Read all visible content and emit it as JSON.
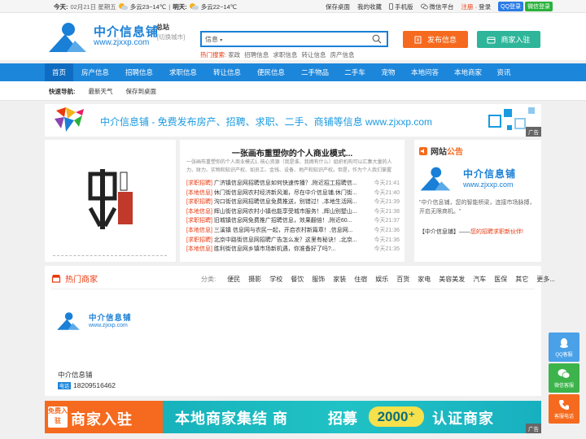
{
  "topbar": {
    "today_label": "今天:",
    "date": "02月21日 星期五",
    "today_weather": "多云23~14℃",
    "tomorrow_label": "明天:",
    "tomorrow_weather": "多云22~14℃",
    "links": [
      "保存桌面",
      "我的收藏",
      "手机版",
      "微信平台"
    ],
    "register": "注册",
    "login": "登录",
    "qq_login": "QQ登录",
    "wechat_login": "微信登录"
  },
  "header": {
    "logo_text": "中介信息铺",
    "logo_url": "www.zjxxp.com",
    "site_name": "总站",
    "switch_city": "[切换城市]",
    "search_type": "信息",
    "hot_label": "热门搜索:",
    "hot_keywords": [
      "家政",
      "招聘信息",
      "求职信息",
      "转让信息",
      "房产信息"
    ],
    "post_button": "发布信息",
    "join_button": "商家入驻"
  },
  "nav": {
    "items": [
      "首页",
      "房产信息",
      "招聘信息",
      "求职信息",
      "转让信息",
      "便民信息",
      "二手物品",
      "二手车",
      "宠物",
      "本地问答",
      "本地商家",
      "资讯"
    ]
  },
  "quick": {
    "label": "快速导航:",
    "links": [
      "最新天气",
      "保存到桌面"
    ]
  },
  "banner1": {
    "slogan": "中介信息铺 - 免费发布房产、招聘、求职、二手、商铺等信息 www.zjxxp.com",
    "ad": "广告"
  },
  "news": {
    "title": "一张画布重塑你的个人商业模式...",
    "desc": "一张画布重塑你的个人商业模式1. 核心资源（我是谁、我拥有什么）组织机构可以汇集大量的人力、财力、实物和知识产权、如员工、金钱、设备、地产和知识产权。但是，作为个人我们掌握",
    "items": [
      {
        "cat": "[求职招聘]",
        "text": "广济镇信息网招聘信息如何快速传播？,附近招工招聘信...",
        "time": "今天21:41"
      },
      {
        "cat": "[本地信息]",
        "text": "休门街信息网农村经济新风潮，尽在中介信息铺,休门街...",
        "time": "今天21:40"
      },
      {
        "cat": "[求职招聘]",
        "text": "沟口街信息网招聘信息免费推送，别错过！,本地生活网...",
        "time": "今天21:39"
      },
      {
        "cat": "[本地信息]",
        "text": "辉山街信息网农村小镇也能享受城市服务！,辉山别墅山...",
        "time": "今天21:38"
      },
      {
        "cat": "[求职招聘]",
        "text": "旧城镇信息网免费推广招聘信息，效果翻倍！,附近60...",
        "time": "今天21:37"
      },
      {
        "cat": "[本地信息]",
        "text": "三溪镇 信息网与农民一起，开启农村新篇章！,信息网...",
        "time": "今天21:36"
      },
      {
        "cat": "[求职招聘]",
        "text": "北京中路街信息网招聘广告怎么发？这里有秘诀！,北京...",
        "time": "今天21:36"
      },
      {
        "cat": "[本地信息]",
        "text": "胜利街信息网乡镇市场新机遇，你准备好了吗?...",
        "time": "今天21:35"
      }
    ]
  },
  "announce": {
    "title_prefix": "网站",
    "title_suffix": "公告",
    "logo_text": "中介信息铺",
    "logo_url": "www.zjxxp.com",
    "desc": "\"中介信息铺，您的智能桥梁，连接市场脉搏，开启无限商机。\"",
    "foot_prefix": "【中介信息铺】——",
    "foot_suffix": "您的招聘求职新伙伴!"
  },
  "merchant": {
    "title": "热门商家",
    "cats_label": "分类:",
    "cats": [
      "便民",
      "摄影",
      "学校",
      "餐饮",
      "服饰",
      "家装",
      "住宿",
      "娱乐",
      "百货",
      "家电",
      "美容美发",
      "汽车",
      "医保",
      "其它",
      "更多..."
    ],
    "logo_text": "中介信息铺",
    "logo_url": "www.zjxxp.com",
    "name": "中介信息铺",
    "tel_tag": "电话",
    "tel": "18209516462"
  },
  "banner2": {
    "free": "免费入驻",
    "join": "商家入驻",
    "text1": "本地商家集结",
    "shang": "商",
    "zhaomu": "招募",
    "number": "2000⁺",
    "text2": "认证商家",
    "ad": "广告"
  },
  "float": {
    "qq": "QQ客服",
    "wechat": "微信客服",
    "tel": "客服电话"
  },
  "colors": {
    "primary": "#1c86db",
    "orange": "#f56a1e",
    "teal": "#2eb59a",
    "red": "#e8380d"
  }
}
